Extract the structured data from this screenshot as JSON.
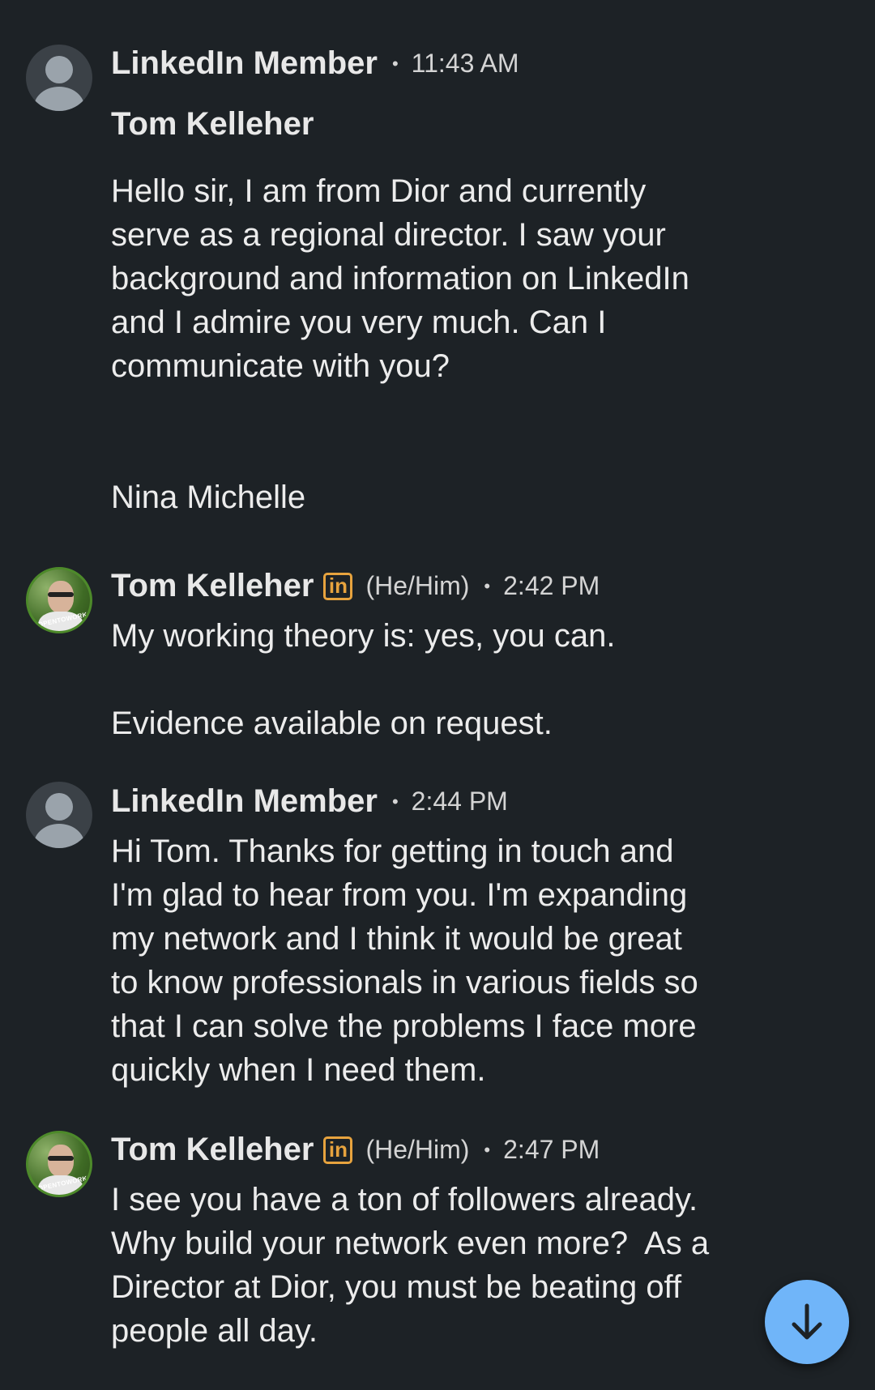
{
  "messages": [
    {
      "sender": "LinkedIn Member",
      "time": "11:43 AM",
      "subject": "Tom Kelleher",
      "body": "Hello sir, I am from Dior and currently\nserve as a regional director. I saw your\nbackground and information on LinkedIn\nand I admire you very much. Can I\ncommunicate with you?\n\n\nNina Michelle"
    },
    {
      "sender": "Tom Kelleher",
      "badge": "in",
      "pronouns": "(He/Him)",
      "time": "2:42 PM",
      "body": "My working theory is: yes, you can.\n\nEvidence available on request."
    },
    {
      "sender": "LinkedIn Member",
      "time": "2:44 PM",
      "body": "Hi Tom. Thanks for getting in touch and\nI'm glad to hear from you. I'm expanding\nmy network and I think it would be great\nto know professionals in various fields so\nthat I can solve the problems I face more\nquickly when I need them."
    },
    {
      "sender": "Tom Kelleher",
      "badge": "in",
      "pronouns": "(He/Him)",
      "time": "2:47 PM",
      "body": "I see you have a ton of followers already.\nWhy build your network even more?  As a\nDirector at Dior, you must be beating off\npeople all day."
    }
  ],
  "separator": "•",
  "avatar_frame_text": "#OPENTOWORK",
  "scroll_button_icon": "arrow-down-icon",
  "colors": {
    "background": "#1d2226",
    "badge": "#e7a33e",
    "fab": "#70b5f9"
  }
}
